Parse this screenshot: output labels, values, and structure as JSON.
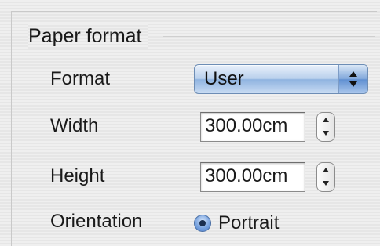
{
  "section": {
    "title": "Paper format"
  },
  "format": {
    "label": "Format",
    "value": "User",
    "icon": "chevron-updown-icon"
  },
  "width": {
    "label": "Width",
    "value": "300.00cm",
    "icon": "stepper-icon"
  },
  "height": {
    "label": "Height",
    "value": "300.00cm",
    "icon": "stepper-icon"
  },
  "orientation": {
    "label": "Orientation",
    "option_label": "Portrait",
    "selected": true
  },
  "colors": {
    "accent": "#7fa6da",
    "radio": "#4d7fcc"
  }
}
